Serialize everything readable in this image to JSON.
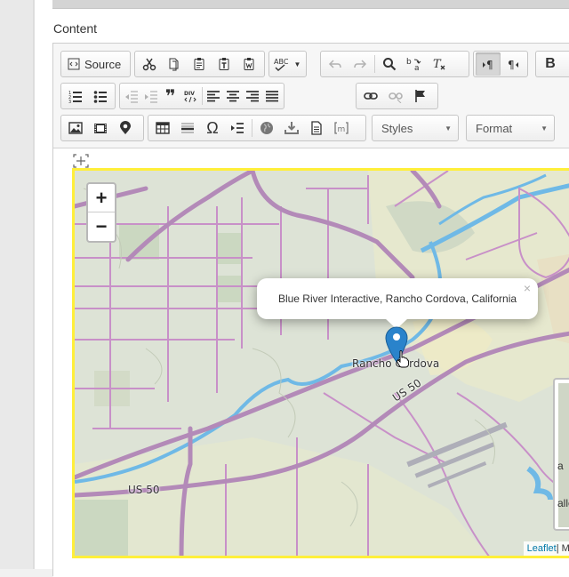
{
  "field": {
    "label": "Content"
  },
  "toolbar": {
    "source_label": "Source",
    "styles_label": "Styles",
    "format_label": "Format",
    "bold_label": "B"
  },
  "map": {
    "popup_text": "Blue River Interactive, Rancho Cordova, California",
    "popup_close": "×",
    "zoom_in": "+",
    "zoom_out": "−",
    "place_label": "Rancho Cordova",
    "highway_label_1": "US 50",
    "highway_label_2": "US 50",
    "attribution_link": "Leaflet",
    "attribution_rest": " | Map",
    "layer_text_1": "a",
    "layer_text_2": "alle"
  },
  "colors": {
    "editor_selection": "#ffef3a",
    "road": "#c890c8",
    "water": "#5aaee0",
    "marker": "#2a83cb"
  }
}
